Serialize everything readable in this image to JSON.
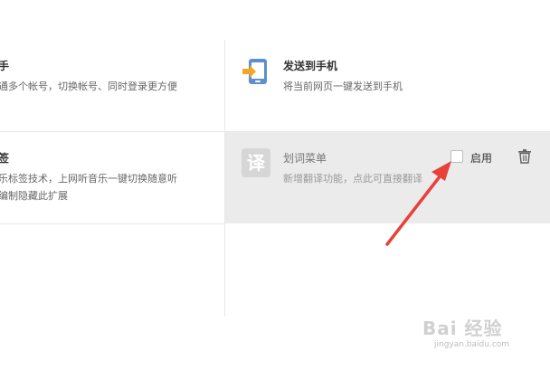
{
  "extensions": [
    {
      "title": "手",
      "desc_lines": [
        "通多个帐号，切换帐号、同时登录更方便"
      ]
    },
    {
      "title": "发送到手机",
      "desc_lines": [
        "将当前网页一键发送到手机"
      ],
      "icon": "phone-send-icon"
    },
    {
      "title": "签",
      "desc_lines": [
        "乐标签技术，上网听音乐一键切换随意听",
        "编制隐藏此扩展"
      ]
    },
    {
      "title": "划词菜单",
      "desc_lines": [
        "新增翻译功能，点此可直接翻译"
      ],
      "icon": "translate-icon",
      "icon_glyph": "译",
      "enable_label": "启用",
      "enabled": false,
      "disabled": true
    }
  ],
  "watermark": {
    "brand": "Bai 经验",
    "url": "jingyan.baidu.com"
  },
  "colors": {
    "accent_arrow": "#e8413a",
    "disabled_bg": "#ebebeb",
    "phone_blue": "#5b8fcf",
    "arrow_orange": "#f5a623"
  }
}
